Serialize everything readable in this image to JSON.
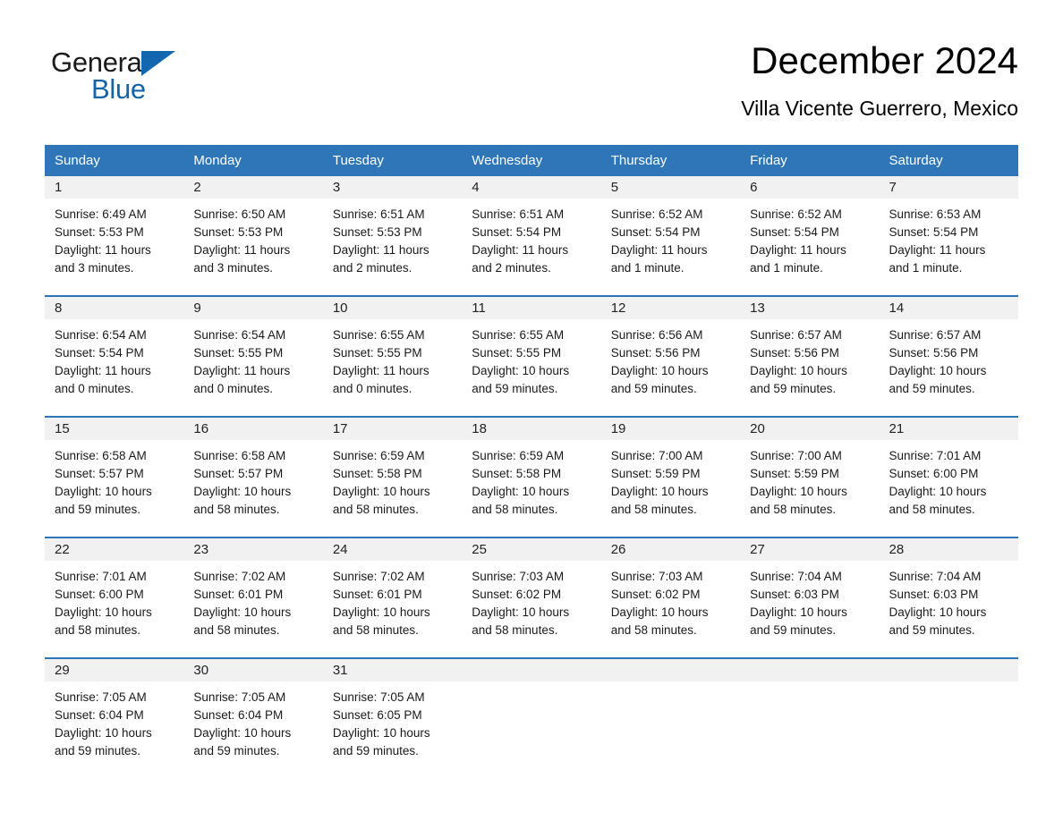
{
  "brand": {
    "name_part1": "General",
    "name_part2": "Blue",
    "logo_icon": "blue-triangle-logo"
  },
  "header": {
    "title": "December 2024",
    "location": "Villa Vicente Guerrero, Mexico"
  },
  "colors": {
    "header_blue": "#2e76b8",
    "brand_blue": "#1464aa",
    "daynum_bg": "#f1f1f1",
    "text": "#1a1a1a"
  },
  "weekday_headers": [
    "Sunday",
    "Monday",
    "Tuesday",
    "Wednesday",
    "Thursday",
    "Friday",
    "Saturday"
  ],
  "weeks": [
    [
      {
        "day": "1",
        "sunrise": "Sunrise: 6:49 AM",
        "sunset": "Sunset: 5:53 PM",
        "daylight_line1": "Daylight: 11 hours",
        "daylight_line2": "and 3 minutes."
      },
      {
        "day": "2",
        "sunrise": "Sunrise: 6:50 AM",
        "sunset": "Sunset: 5:53 PM",
        "daylight_line1": "Daylight: 11 hours",
        "daylight_line2": "and 3 minutes."
      },
      {
        "day": "3",
        "sunrise": "Sunrise: 6:51 AM",
        "sunset": "Sunset: 5:53 PM",
        "daylight_line1": "Daylight: 11 hours",
        "daylight_line2": "and 2 minutes."
      },
      {
        "day": "4",
        "sunrise": "Sunrise: 6:51 AM",
        "sunset": "Sunset: 5:54 PM",
        "daylight_line1": "Daylight: 11 hours",
        "daylight_line2": "and 2 minutes."
      },
      {
        "day": "5",
        "sunrise": "Sunrise: 6:52 AM",
        "sunset": "Sunset: 5:54 PM",
        "daylight_line1": "Daylight: 11 hours",
        "daylight_line2": "and 1 minute."
      },
      {
        "day": "6",
        "sunrise": "Sunrise: 6:52 AM",
        "sunset": "Sunset: 5:54 PM",
        "daylight_line1": "Daylight: 11 hours",
        "daylight_line2": "and 1 minute."
      },
      {
        "day": "7",
        "sunrise": "Sunrise: 6:53 AM",
        "sunset": "Sunset: 5:54 PM",
        "daylight_line1": "Daylight: 11 hours",
        "daylight_line2": "and 1 minute."
      }
    ],
    [
      {
        "day": "8",
        "sunrise": "Sunrise: 6:54 AM",
        "sunset": "Sunset: 5:54 PM",
        "daylight_line1": "Daylight: 11 hours",
        "daylight_line2": "and 0 minutes."
      },
      {
        "day": "9",
        "sunrise": "Sunrise: 6:54 AM",
        "sunset": "Sunset: 5:55 PM",
        "daylight_line1": "Daylight: 11 hours",
        "daylight_line2": "and 0 minutes."
      },
      {
        "day": "10",
        "sunrise": "Sunrise: 6:55 AM",
        "sunset": "Sunset: 5:55 PM",
        "daylight_line1": "Daylight: 11 hours",
        "daylight_line2": "and 0 minutes."
      },
      {
        "day": "11",
        "sunrise": "Sunrise: 6:55 AM",
        "sunset": "Sunset: 5:55 PM",
        "daylight_line1": "Daylight: 10 hours",
        "daylight_line2": "and 59 minutes."
      },
      {
        "day": "12",
        "sunrise": "Sunrise: 6:56 AM",
        "sunset": "Sunset: 5:56 PM",
        "daylight_line1": "Daylight: 10 hours",
        "daylight_line2": "and 59 minutes."
      },
      {
        "day": "13",
        "sunrise": "Sunrise: 6:57 AM",
        "sunset": "Sunset: 5:56 PM",
        "daylight_line1": "Daylight: 10 hours",
        "daylight_line2": "and 59 minutes."
      },
      {
        "day": "14",
        "sunrise": "Sunrise: 6:57 AM",
        "sunset": "Sunset: 5:56 PM",
        "daylight_line1": "Daylight: 10 hours",
        "daylight_line2": "and 59 minutes."
      }
    ],
    [
      {
        "day": "15",
        "sunrise": "Sunrise: 6:58 AM",
        "sunset": "Sunset: 5:57 PM",
        "daylight_line1": "Daylight: 10 hours",
        "daylight_line2": "and 59 minutes."
      },
      {
        "day": "16",
        "sunrise": "Sunrise: 6:58 AM",
        "sunset": "Sunset: 5:57 PM",
        "daylight_line1": "Daylight: 10 hours",
        "daylight_line2": "and 58 minutes."
      },
      {
        "day": "17",
        "sunrise": "Sunrise: 6:59 AM",
        "sunset": "Sunset: 5:58 PM",
        "daylight_line1": "Daylight: 10 hours",
        "daylight_line2": "and 58 minutes."
      },
      {
        "day": "18",
        "sunrise": "Sunrise: 6:59 AM",
        "sunset": "Sunset: 5:58 PM",
        "daylight_line1": "Daylight: 10 hours",
        "daylight_line2": "and 58 minutes."
      },
      {
        "day": "19",
        "sunrise": "Sunrise: 7:00 AM",
        "sunset": "Sunset: 5:59 PM",
        "daylight_line1": "Daylight: 10 hours",
        "daylight_line2": "and 58 minutes."
      },
      {
        "day": "20",
        "sunrise": "Sunrise: 7:00 AM",
        "sunset": "Sunset: 5:59 PM",
        "daylight_line1": "Daylight: 10 hours",
        "daylight_line2": "and 58 minutes."
      },
      {
        "day": "21",
        "sunrise": "Sunrise: 7:01 AM",
        "sunset": "Sunset: 6:00 PM",
        "daylight_line1": "Daylight: 10 hours",
        "daylight_line2": "and 58 minutes."
      }
    ],
    [
      {
        "day": "22",
        "sunrise": "Sunrise: 7:01 AM",
        "sunset": "Sunset: 6:00 PM",
        "daylight_line1": "Daylight: 10 hours",
        "daylight_line2": "and 58 minutes."
      },
      {
        "day": "23",
        "sunrise": "Sunrise: 7:02 AM",
        "sunset": "Sunset: 6:01 PM",
        "daylight_line1": "Daylight: 10 hours",
        "daylight_line2": "and 58 minutes."
      },
      {
        "day": "24",
        "sunrise": "Sunrise: 7:02 AM",
        "sunset": "Sunset: 6:01 PM",
        "daylight_line1": "Daylight: 10 hours",
        "daylight_line2": "and 58 minutes."
      },
      {
        "day": "25",
        "sunrise": "Sunrise: 7:03 AM",
        "sunset": "Sunset: 6:02 PM",
        "daylight_line1": "Daylight: 10 hours",
        "daylight_line2": "and 58 minutes."
      },
      {
        "day": "26",
        "sunrise": "Sunrise: 7:03 AM",
        "sunset": "Sunset: 6:02 PM",
        "daylight_line1": "Daylight: 10 hours",
        "daylight_line2": "and 58 minutes."
      },
      {
        "day": "27",
        "sunrise": "Sunrise: 7:04 AM",
        "sunset": "Sunset: 6:03 PM",
        "daylight_line1": "Daylight: 10 hours",
        "daylight_line2": "and 59 minutes."
      },
      {
        "day": "28",
        "sunrise": "Sunrise: 7:04 AM",
        "sunset": "Sunset: 6:03 PM",
        "daylight_line1": "Daylight: 10 hours",
        "daylight_line2": "and 59 minutes."
      }
    ],
    [
      {
        "day": "29",
        "sunrise": "Sunrise: 7:05 AM",
        "sunset": "Sunset: 6:04 PM",
        "daylight_line1": "Daylight: 10 hours",
        "daylight_line2": "and 59 minutes."
      },
      {
        "day": "30",
        "sunrise": "Sunrise: 7:05 AM",
        "sunset": "Sunset: 6:04 PM",
        "daylight_line1": "Daylight: 10 hours",
        "daylight_line2": "and 59 minutes."
      },
      {
        "day": "31",
        "sunrise": "Sunrise: 7:05 AM",
        "sunset": "Sunset: 6:05 PM",
        "daylight_line1": "Daylight: 10 hours",
        "daylight_line2": "and 59 minutes."
      },
      {
        "day": "",
        "sunrise": "",
        "sunset": "",
        "daylight_line1": "",
        "daylight_line2": ""
      },
      {
        "day": "",
        "sunrise": "",
        "sunset": "",
        "daylight_line1": "",
        "daylight_line2": ""
      },
      {
        "day": "",
        "sunrise": "",
        "sunset": "",
        "daylight_line1": "",
        "daylight_line2": ""
      },
      {
        "day": "",
        "sunrise": "",
        "sunset": "",
        "daylight_line1": "",
        "daylight_line2": ""
      }
    ]
  ]
}
